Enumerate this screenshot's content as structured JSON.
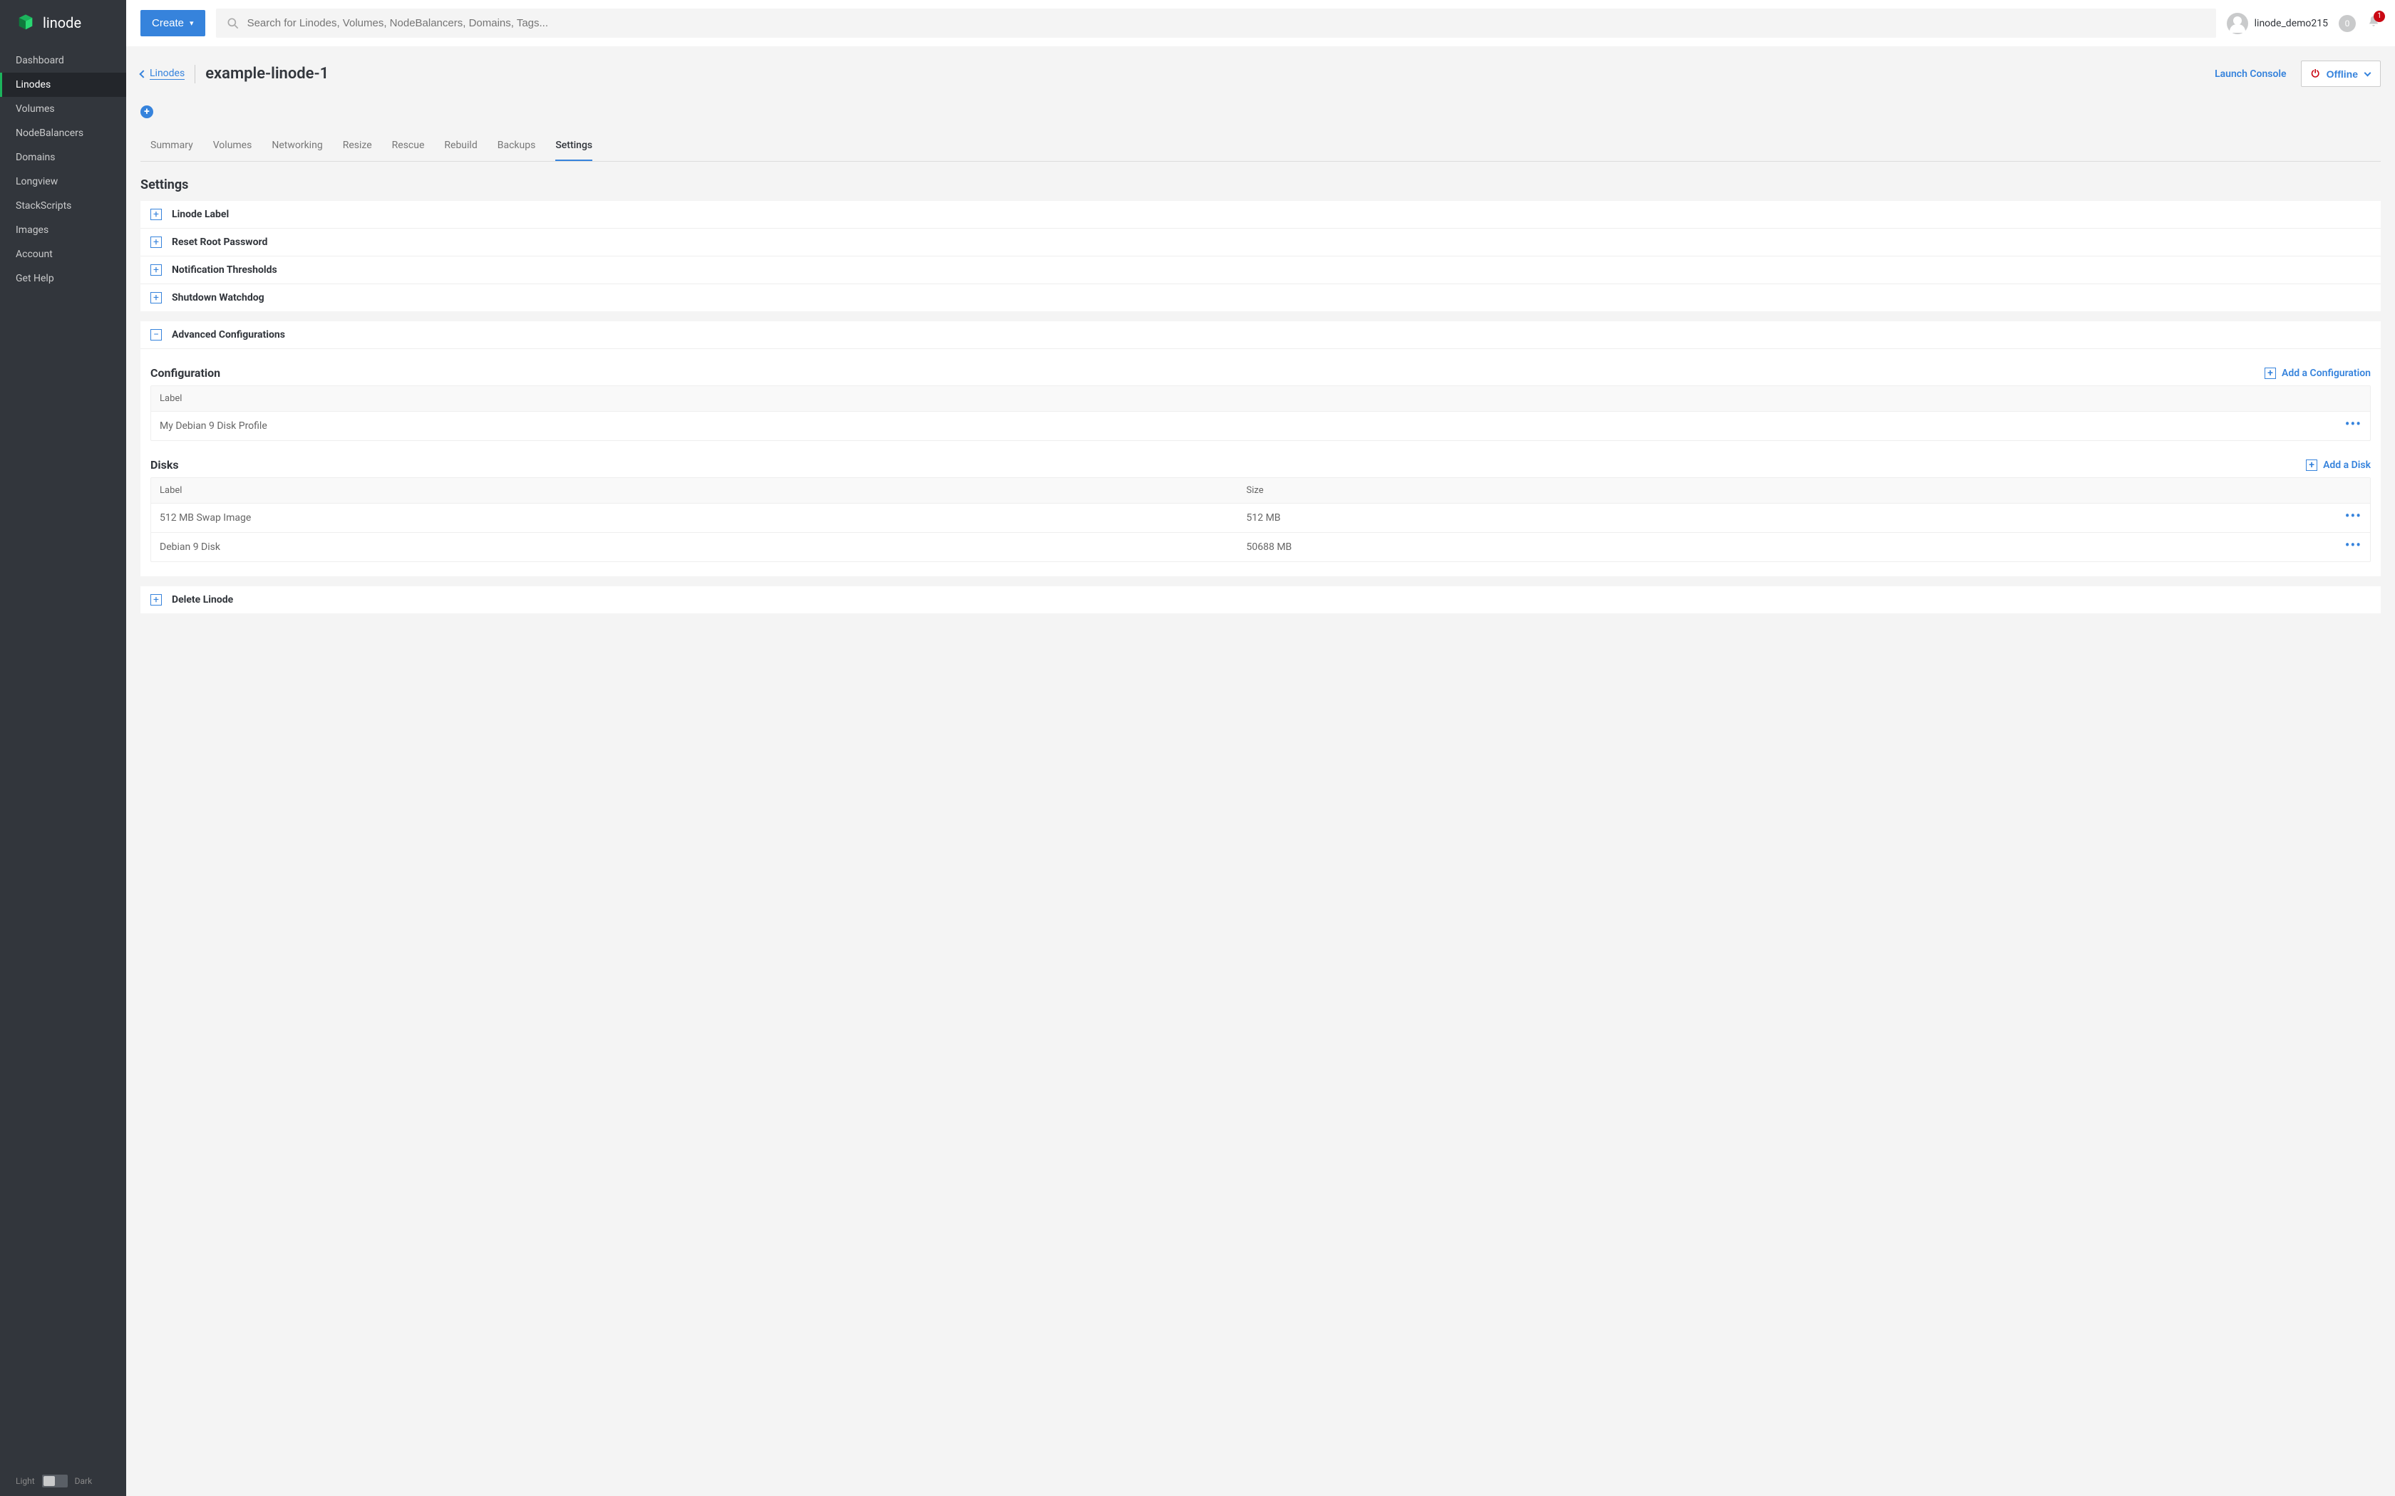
{
  "brand": {
    "name": "linode"
  },
  "sidebar": {
    "items": [
      {
        "label": "Dashboard"
      },
      {
        "label": "Linodes"
      },
      {
        "label": "Volumes"
      },
      {
        "label": "NodeBalancers"
      },
      {
        "label": "Domains"
      },
      {
        "label": "Longview"
      },
      {
        "label": "StackScripts"
      },
      {
        "label": "Images"
      },
      {
        "label": "Account"
      },
      {
        "label": "Get Help"
      }
    ],
    "active_index": 1,
    "theme_light": "Light",
    "theme_dark": "Dark"
  },
  "topbar": {
    "create_label": "Create",
    "search_placeholder": "Search for Linodes, Volumes, NodeBalancers, Domains, Tags...",
    "username": "linode_demo215",
    "gray_badge": "0",
    "bell_count": "1"
  },
  "header": {
    "breadcrumb": "Linodes",
    "title": "example-linode-1",
    "launch_console": "Launch Console",
    "offline": "Offline"
  },
  "tabs": [
    {
      "label": "Summary"
    },
    {
      "label": "Volumes"
    },
    {
      "label": "Networking"
    },
    {
      "label": "Resize"
    },
    {
      "label": "Rescue"
    },
    {
      "label": "Rebuild"
    },
    {
      "label": "Backups"
    },
    {
      "label": "Settings"
    }
  ],
  "tabs_active_index": 7,
  "section_heading": "Settings",
  "panels": [
    {
      "label": "Linode Label",
      "icon": "+"
    },
    {
      "label": "Reset Root Password",
      "icon": "+"
    },
    {
      "label": "Notification Thresholds",
      "icon": "+"
    },
    {
      "label": "Shutdown Watchdog",
      "icon": "+"
    }
  ],
  "advanced": {
    "label": "Advanced Configurations",
    "icon": "−"
  },
  "config": {
    "heading": "Configuration",
    "add_label": "Add a Configuration",
    "header_label": "Label",
    "rows": [
      {
        "label": "My Debian 9 Disk Profile"
      }
    ]
  },
  "disks": {
    "heading": "Disks",
    "add_label": "Add a Disk",
    "header_label": "Label",
    "header_size": "Size",
    "rows": [
      {
        "label": "512 MB Swap Image",
        "size": "512 MB"
      },
      {
        "label": "Debian 9 Disk",
        "size": "50688 MB"
      }
    ]
  },
  "delete": {
    "label": "Delete Linode",
    "icon": "+"
  },
  "glyphs": {
    "plus": "+"
  }
}
